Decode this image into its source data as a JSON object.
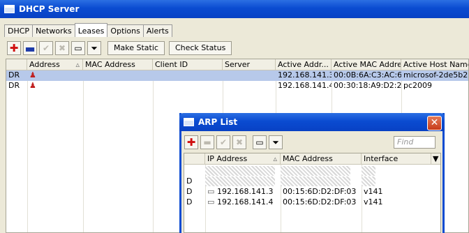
{
  "dhcp": {
    "title": "DHCP Server",
    "tabs": [
      "DHCP",
      "Networks",
      "Leases",
      "Options",
      "Alerts"
    ],
    "active_tab": "Leases",
    "buttons": {
      "make_static": "Make Static",
      "check_status": "Check Status"
    },
    "columns": [
      "",
      "Address",
      "MAC Address",
      "Client ID",
      "Server",
      "Active Addr...",
      "Active MAC Addre...",
      "Active Host Name"
    ],
    "rows": [
      {
        "flag": "DR",
        "address": "",
        "mac": "",
        "client_id": "",
        "server": "",
        "active_addr": "192.168.141.3",
        "active_mac": "00:0B:6A:C3:AC:63",
        "host": "microsof-2de5b2",
        "selected": true
      },
      {
        "flag": "DR",
        "address": "",
        "mac": "",
        "client_id": "",
        "server": "",
        "active_addr": "192.168.141.4",
        "active_mac": "00:30:18:A9:D2:2E",
        "host": "pc2009",
        "selected": false
      }
    ]
  },
  "arp": {
    "title": "ARP List",
    "find_placeholder": "Find",
    "columns": [
      "",
      "IP Address",
      "MAC Address",
      "Interface"
    ],
    "rows": [
      {
        "flag": "",
        "ip": "",
        "mac": "",
        "iface": "",
        "redacted": true
      },
      {
        "flag": "D",
        "ip": "",
        "mac": "",
        "iface": "",
        "redacted": true
      },
      {
        "flag": "D",
        "ip": "192.168.141.3",
        "mac": "00:15:6D:D2:DF:03",
        "iface": "v141",
        "redacted": false
      },
      {
        "flag": "D",
        "ip": "192.168.141.4",
        "mac": "00:15:6D:D2:DF:03",
        "iface": "v141",
        "redacted": false
      }
    ]
  },
  "colors": {
    "titlebar": "#0a4bd1",
    "selection": "#b7c9ea",
    "add_icon": "#d01010",
    "remove_icon": "#1c3aa8"
  },
  "icons": [
    "add-icon",
    "remove-icon",
    "check-icon",
    "cross-icon",
    "comment-icon",
    "filter-icon",
    "lease-icon",
    "close-icon",
    "sort-arrow-icon",
    "column-menu-icon"
  ]
}
